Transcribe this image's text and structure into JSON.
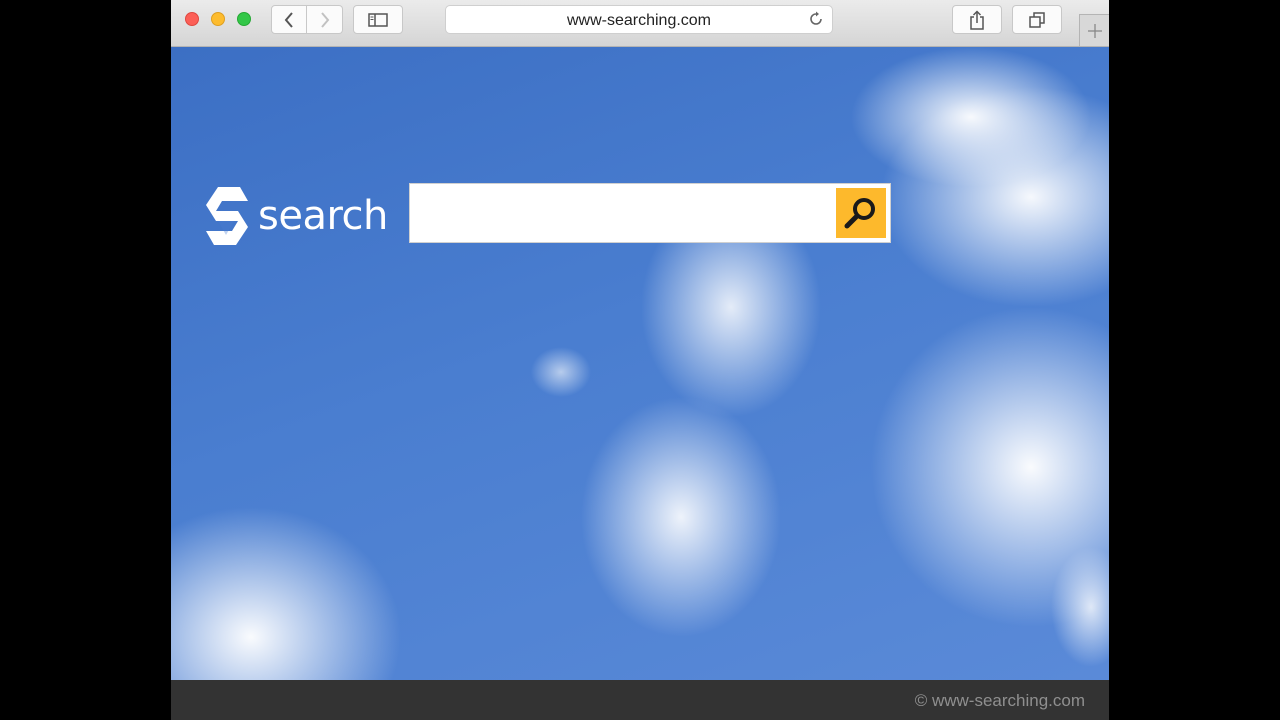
{
  "browser": {
    "address_bar": {
      "url": "www-searching.com"
    },
    "buttons": {
      "back": "back-icon",
      "forward": "forward-icon",
      "sidebar": "sidebar-icon",
      "reload": "reload-icon",
      "share": "share-icon",
      "tabs": "tabs-icon",
      "new_tab": "plus-icon"
    }
  },
  "page": {
    "logo_text": "search",
    "search": {
      "value": "",
      "placeholder": ""
    },
    "footer": {
      "copyright": "© www-searching.com"
    }
  },
  "colors": {
    "accent": "#fdb92c",
    "sky": "#4a7ed0",
    "footer_bg": "#333333"
  }
}
